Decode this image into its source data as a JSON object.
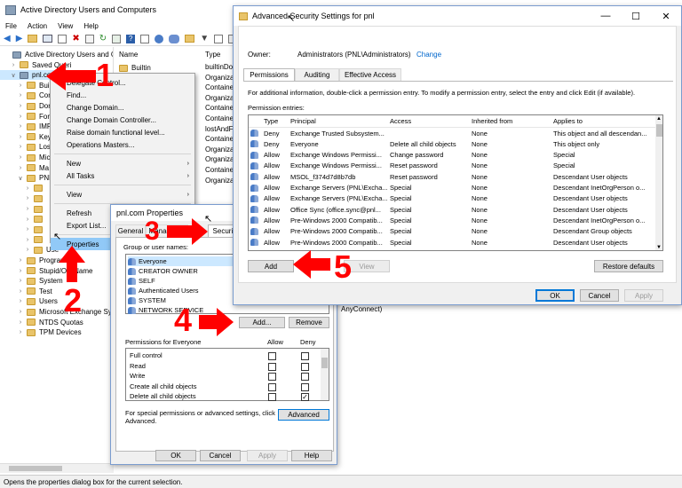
{
  "main_window": {
    "title": "Active Directory Users and Computers",
    "menu": [
      "File",
      "Action",
      "View",
      "Help"
    ],
    "status_text": "Opens the properties dialog box for the current selection.",
    "tree": [
      {
        "label": "Active Directory Users and Com",
        "indent": 0,
        "exp": ""
      },
      {
        "label": "Saved Queri",
        "indent": 1,
        "exp": ">"
      },
      {
        "label": "pnl.com",
        "indent": 1,
        "exp": "v"
      },
      {
        "label": "Buil",
        "indent": 2,
        "exp": ">"
      },
      {
        "label": "Cor",
        "indent": 2,
        "exp": ">"
      },
      {
        "label": "Dor",
        "indent": 2,
        "exp": ">"
      },
      {
        "label": "For",
        "indent": 2,
        "exp": ">"
      },
      {
        "label": "IMP",
        "indent": 2,
        "exp": ">"
      },
      {
        "label": "Key",
        "indent": 2,
        "exp": ">"
      },
      {
        "label": "Los",
        "indent": 2,
        "exp": ">"
      },
      {
        "label": "Mic",
        "indent": 2,
        "exp": ">"
      },
      {
        "label": "Ma",
        "indent": 2,
        "exp": ">"
      },
      {
        "label": "PNL",
        "indent": 2,
        "exp": "v"
      },
      {
        "label": "",
        "indent": 3,
        "exp": ">"
      },
      {
        "label": "",
        "indent": 3,
        "exp": ">"
      },
      {
        "label": "",
        "indent": 3,
        "exp": ">"
      },
      {
        "label": "",
        "indent": 3,
        "exp": ">"
      },
      {
        "label": "",
        "indent": 3,
        "exp": ">"
      },
      {
        "label": "",
        "indent": 3,
        "exp": ">"
      },
      {
        "label": "Use",
        "indent": 3,
        "exp": ">"
      },
      {
        "label": "Program",
        "indent": 2,
        "exp": ">"
      },
      {
        "label": "Stupid/OU/Name",
        "indent": 2,
        "exp": ">"
      },
      {
        "label": "System",
        "indent": 2,
        "exp": ">"
      },
      {
        "label": "Test",
        "indent": 2,
        "exp": ">"
      },
      {
        "label": "Users",
        "indent": 2,
        "exp": ">"
      },
      {
        "label": "Microsoft Exchange Syst",
        "indent": 2,
        "exp": ">"
      },
      {
        "label": "NTDS Quotas",
        "indent": 2,
        "exp": ">"
      },
      {
        "label": "TPM Devices",
        "indent": 2,
        "exp": ">"
      }
    ],
    "list_headers": [
      "Name",
      "Type"
    ],
    "list_items": [
      {
        "name": "Builtin",
        "type": "builtinDo"
      },
      {
        "name": "",
        "type": "Organiza"
      },
      {
        "name": "",
        "type": "Containe"
      },
      {
        "name": "",
        "type": "Organiza"
      },
      {
        "name": "",
        "type": "Containe"
      },
      {
        "name": "",
        "type": "Containe"
      },
      {
        "name": "",
        "type": "lostAndF"
      },
      {
        "name": "",
        "type": "Containe"
      },
      {
        "name": "",
        "type": "Organiza"
      },
      {
        "name": "",
        "type": "Organiza"
      },
      {
        "name": "",
        "type": "Containe"
      },
      {
        "name": "",
        "type": "Organiza"
      }
    ],
    "anyconnect_text": "AnyConnect)"
  },
  "context_menu": {
    "items": [
      {
        "label": "Delegate Control...",
        "sub": false
      },
      {
        "label": "Find...",
        "sub": false
      },
      {
        "label": "Change Domain...",
        "sub": false
      },
      {
        "label": "Change Domain Controller...",
        "sub": false
      },
      {
        "label": "Raise domain functional level...",
        "sub": false
      },
      {
        "label": "Operations Masters...",
        "sub": false
      },
      {
        "sep": true
      },
      {
        "label": "New",
        "sub": true
      },
      {
        "label": "All Tasks",
        "sub": true
      },
      {
        "sep": true
      },
      {
        "label": "View",
        "sub": true
      },
      {
        "sep": true
      },
      {
        "label": "Refresh",
        "sub": false
      },
      {
        "label": "Export List...",
        "sub": false
      },
      {
        "sep": true
      },
      {
        "label": "Properties",
        "sub": false,
        "selected": true
      }
    ]
  },
  "properties_dialog": {
    "title": "pnl.com Properties",
    "tabs": [
      "General",
      "Managed B",
      "Security"
    ],
    "group_label": "Group or user names:",
    "principals": [
      "Everyone",
      "CREATOR OWNER",
      "SELF",
      "Authenticated Users",
      "SYSTEM",
      "NETWORK SERVICE"
    ],
    "add_label": "Add...",
    "remove_label": "Remove",
    "permissions_label": "Permissions for Everyone",
    "allow_label": "Allow",
    "deny_label": "Deny",
    "permissions": [
      {
        "name": "Full control",
        "allow": false,
        "deny": false
      },
      {
        "name": "Read",
        "allow": false,
        "deny": false
      },
      {
        "name": "Write",
        "allow": false,
        "deny": false
      },
      {
        "name": "Create all child objects",
        "allow": false,
        "deny": false
      },
      {
        "name": "Delete all child objects",
        "allow": false,
        "deny": true
      }
    ],
    "special_text": "For special permissions or advanced settings, click Advanced.",
    "advanced_label": "Advanced",
    "ok_label": "OK",
    "cancel_label": "Cancel",
    "apply_label": "Apply",
    "help_label": "Help"
  },
  "advanced_dialog": {
    "title": "Advanced Security Settings for pnl",
    "owner_label": "Owner:",
    "owner_value": "Administrators (PNL\\Administrators)",
    "change_label": "Change",
    "tabs": [
      "Permissions",
      "Auditing",
      "Effective Access"
    ],
    "info_text": "For additional information, double-click a permission entry. To modify a permission entry, select the entry and click Edit (if available).",
    "entries_label": "Permission entries:",
    "columns": [
      "Type",
      "Principal",
      "Access",
      "Inherited from",
      "Applies to"
    ],
    "rows": [
      [
        "Deny",
        "Exchange Trusted Subsystem...",
        "",
        "None",
        "This object and all descendan..."
      ],
      [
        "Deny",
        "Everyone",
        "Delete all child objects",
        "None",
        "This object only"
      ],
      [
        "Allow",
        "Exchange Windows Permissi...",
        "Change password",
        "None",
        "Special"
      ],
      [
        "Allow",
        "Exchange Windows Permissi...",
        "Reset password",
        "None",
        "Special"
      ],
      [
        "Allow",
        "MSOL_f374d7d8b7db",
        "Reset password",
        "None",
        "Descendant User objects"
      ],
      [
        "Allow",
        "Exchange Servers (PNL\\Excha...",
        "Special",
        "None",
        "Descendant InetOrgPerson o..."
      ],
      [
        "Allow",
        "Exchange Servers (PNL\\Excha...",
        "Special",
        "None",
        "Descendant User objects"
      ],
      [
        "Allow",
        "Office Sync (office.sync@pnl...",
        "Special",
        "None",
        "Descendant User objects"
      ],
      [
        "Allow",
        "Pre-Windows 2000 Compatib...",
        "Special",
        "None",
        "Descendant InetOrgPerson o..."
      ],
      [
        "Allow",
        "Pre-Windows 2000 Compatib...",
        "Special",
        "None",
        "Descendant Group objects"
      ],
      [
        "Allow",
        "Pre-Windows 2000 Compatib...",
        "Special",
        "None",
        "Descendant User objects"
      ]
    ],
    "add_label": "Add",
    "view_label": "View",
    "restore_label": "Restore defaults",
    "ok_label": "OK",
    "cancel_label": "Cancel",
    "apply_label": "Apply"
  },
  "annotations": [
    "1",
    "2",
    "3",
    "4",
    "5"
  ],
  "colors": {
    "annotation": "#ff0000",
    "link": "#0066cc",
    "selection": "#cce8ff",
    "accent": "#0078d7"
  }
}
